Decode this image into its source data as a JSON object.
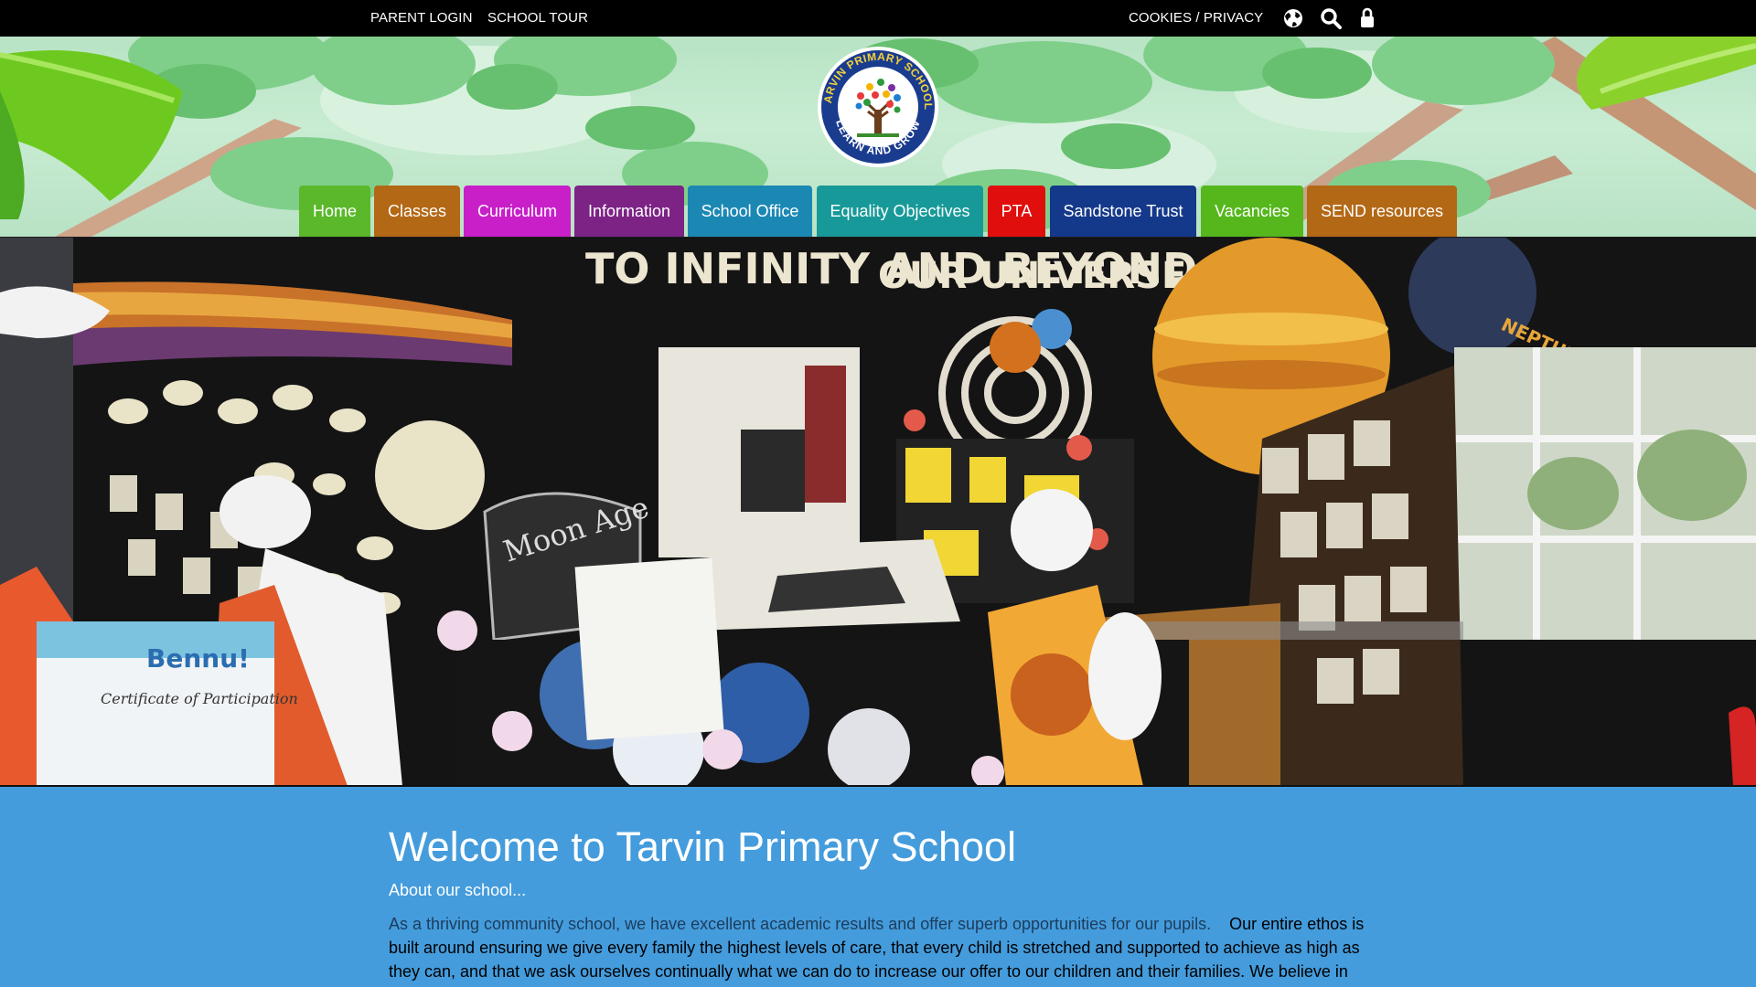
{
  "topbar": {
    "parent_login": "PARENT LOGIN",
    "school_tour": "SCHOOL TOUR",
    "cookies_privacy": "COOKIES / PRIVACY",
    "icons": [
      "globe-icon",
      "search-icon",
      "lock-icon"
    ]
  },
  "logo": {
    "ring_text_top": "TARVIN PRIMARY SCHOOL",
    "ring_text_bottom": "LEARN AND GROW"
  },
  "nav": {
    "items": [
      {
        "label": "Home",
        "color": "#5ab82a"
      },
      {
        "label": "Classes",
        "color": "#b36815"
      },
      {
        "label": "Curriculum",
        "color": "#c81fc8"
      },
      {
        "label": "Information",
        "color": "#7c2385"
      },
      {
        "label": "School Office",
        "color": "#1b88b4"
      },
      {
        "label": "Equality Objectives",
        "color": "#179999"
      },
      {
        "label": "PTA",
        "color": "#e10e0e"
      },
      {
        "label": "Sandstone Trust",
        "color": "#14388a"
      },
      {
        "label": "Vacancies",
        "color": "#55b71c"
      },
      {
        "label": "SEND resources",
        "color": "#b36815"
      }
    ]
  },
  "hero": {
    "wall_text_1": "TO INFINITY AND BEYOND",
    "wall_text_2": "OUR UNIVERSE",
    "planet_label": "NEPTUNE",
    "moon_text": "Moon Age",
    "certificate_text_1": "Bennu!",
    "certificate_text_2": "Certificate of Participation"
  },
  "welcome": {
    "title": "Welcome to Tarvin Primary School",
    "subtitle": "About our school...",
    "lead": "As a thriving community school, we have excellent academic results and offer superb opportunities for our pupils.",
    "body": "Our entire ethos is built around ensuring we give every family the highest levels of care, that every child is stretched and supported to achieve as high as they can, and that we ask ourselves continually what we can do to increase our offer to our children and their families. We believe in"
  },
  "colors": {
    "topbar": "#000000",
    "content_bg": "#449cdc"
  }
}
